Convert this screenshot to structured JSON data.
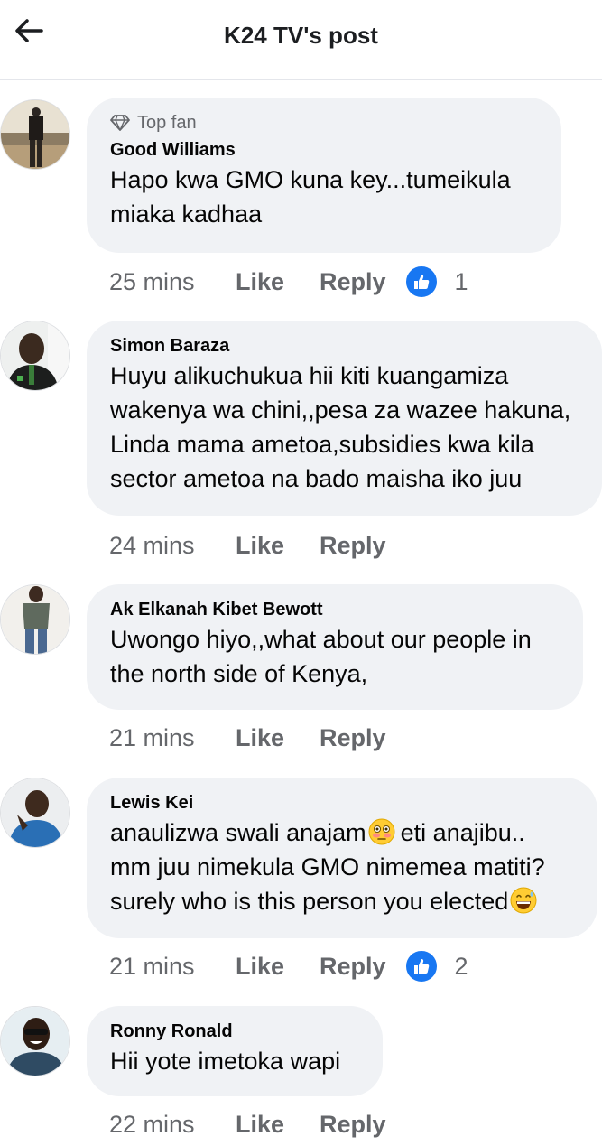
{
  "header": {
    "title": "K24 TV's post",
    "back_icon": "arrow-left-icon"
  },
  "colors": {
    "bubble": "#f0f2f5",
    "secondary_text": "#65676b",
    "like_blue": "#1877f2"
  },
  "comments": [
    {
      "badge": "Top fan",
      "badge_icon": "diamond-icon",
      "author": "Good Williams",
      "lines": [
        "Hapo kwa GMO kuna key...tumeikula",
        "miaka kadhaa"
      ],
      "time": "25 mins",
      "like_label": "Like",
      "reply_label": "Reply",
      "reaction_count": "1"
    },
    {
      "author": "Simon Baraza",
      "lines": [
        "Huyu alikuchukua hii kiti kuangamiza",
        "wakenya wa chini,,pesa za wazee hakuna,",
        "Linda mama ametoa,subsidies kwa kila",
        "sector ametoa na bado maisha iko juu"
      ],
      "time": "24 mins",
      "like_label": "Like",
      "reply_label": "Reply"
    },
    {
      "author": "Ak Elkanah Kibet Bewott",
      "lines": [
        "Uwongo hiyo,,what about our people in",
        "the north side of Kenya,"
      ],
      "time": "21 mins",
      "like_label": "Like",
      "reply_label": "Reply"
    },
    {
      "author": "Lewis Kei",
      "lines": [
        "anaulizwa swali anajam",
        "eti anajibu..",
        "mm juu nimekula GMO nimemea matiti?",
        "surely who is this person you elected"
      ],
      "emojis": [
        "flushed-face-emoji",
        "grinning-sweat-emoji"
      ],
      "time": "21 mins",
      "like_label": "Like",
      "reply_label": "Reply",
      "reaction_count": "2"
    },
    {
      "author": "Ronny Ronald",
      "lines": [
        "Hii yote imetoka wapi"
      ],
      "time": "22 mins",
      "like_label": "Like",
      "reply_label": "Reply"
    }
  ]
}
